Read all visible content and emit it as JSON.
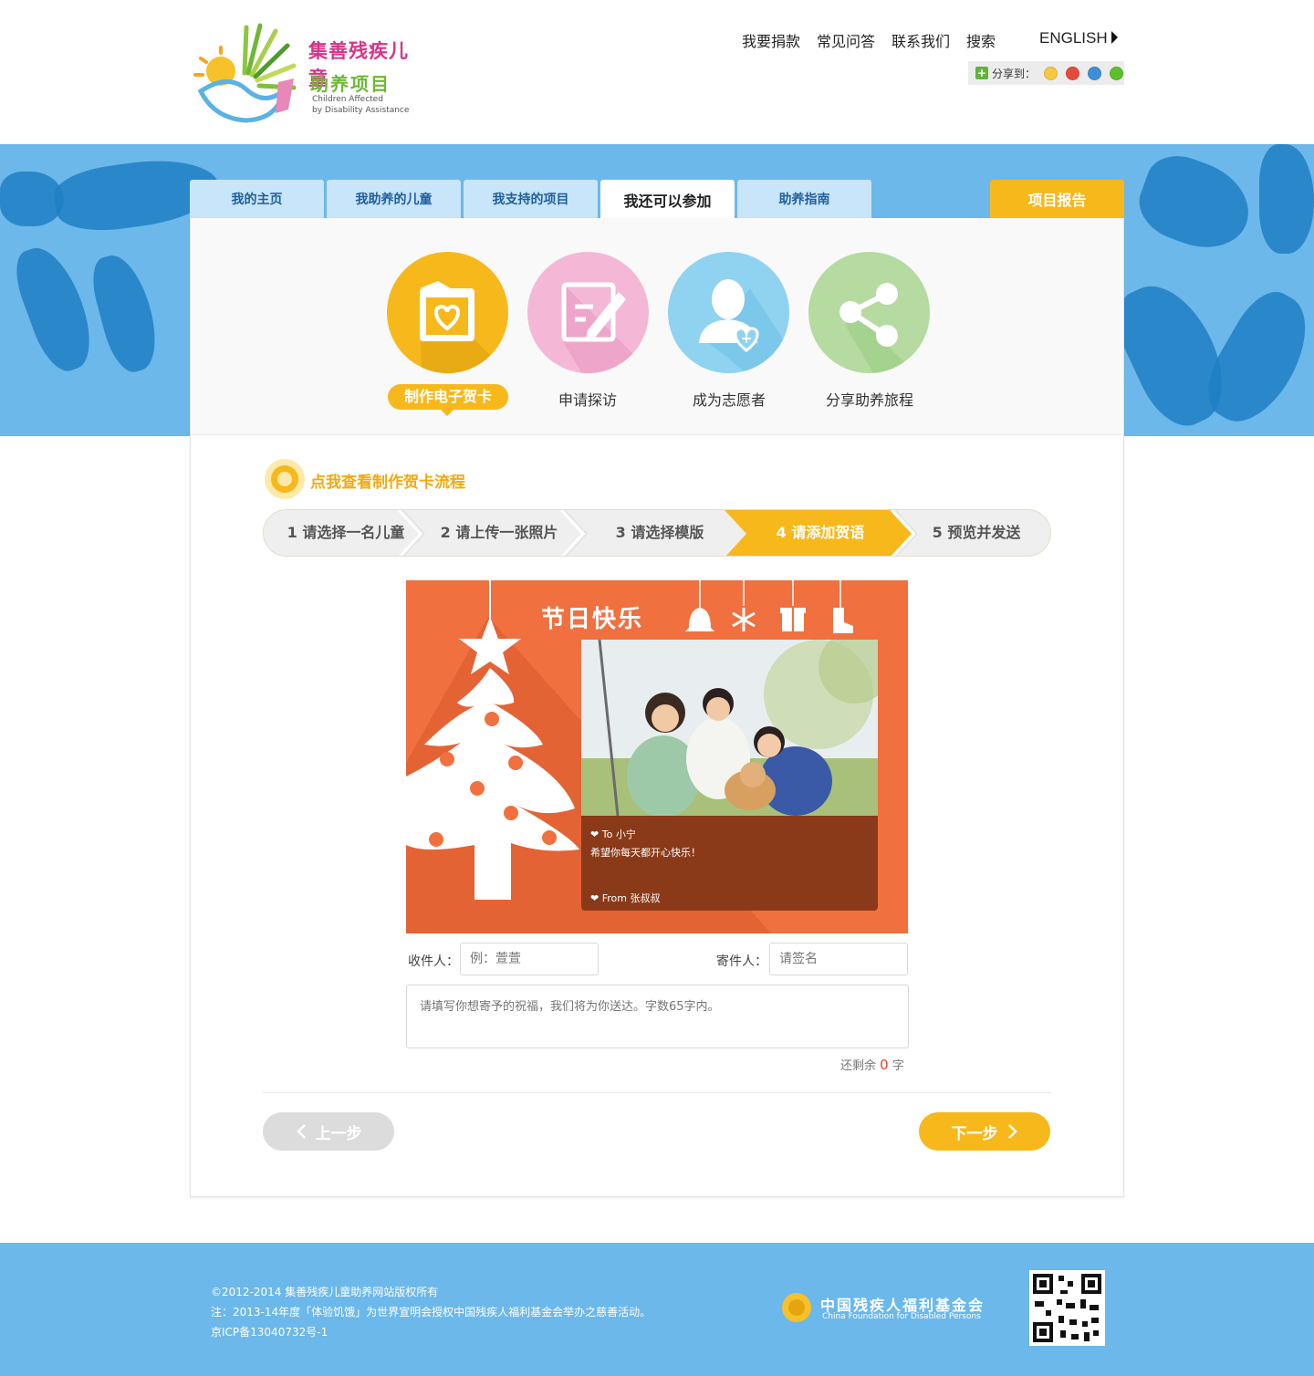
{
  "header": {
    "logo": {
      "title_line1": "集善残疾儿童",
      "title_line2": "助养项目",
      "en_line1": "Children Affected",
      "en_line2": "by Disability Assistance"
    },
    "nav": [
      "我要捐款",
      "常见问答",
      "联系我们",
      "搜索"
    ],
    "english_label": "ENGLISH",
    "share_label": "分享到："
  },
  "tabs": [
    {
      "label": "我的主页"
    },
    {
      "label": "我助养的儿童"
    },
    {
      "label": "我支持的项目"
    },
    {
      "label": "我还可以参加",
      "active": true
    },
    {
      "label": "助养指南"
    }
  ],
  "report_tab": "项目报告",
  "activities": [
    {
      "label": "制作电子贺卡",
      "icon": "ecard-heart-icon",
      "color": "#f7b81c",
      "selected": true
    },
    {
      "label": "申请探访",
      "icon": "edit-form-icon",
      "color": "#f4b8d6"
    },
    {
      "label": "成为志愿者",
      "icon": "volunteer-icon",
      "color": "#8fd3f0"
    },
    {
      "label": "分享助养旅程",
      "icon": "share-icon",
      "color": "#b5dba0"
    }
  ],
  "process_link": "点我查看制作贺卡流程",
  "steps": [
    {
      "num": "1",
      "label": "请选择一名儿童"
    },
    {
      "num": "2",
      "label": "请上传一张照片"
    },
    {
      "num": "3",
      "label": "请选择模版"
    },
    {
      "num": "4",
      "label": "请添加贺语",
      "current": true
    },
    {
      "num": "5",
      "label": "预览并发送"
    }
  ],
  "card": {
    "title": "节日快乐",
    "to_label": "To",
    "to_name": "小宁",
    "message": "希望你每天都开心快乐！",
    "from_label": "From",
    "from_name": "张叔叔"
  },
  "form": {
    "recipient_label": "收件人：",
    "recipient_placeholder": "例：萱萱",
    "sender_label": "寄件人：",
    "sender_placeholder": "请签名",
    "blessing_placeholder": "请填写你想寄予的祝福，我们将为你送达。字数65字内。",
    "remain_prefix": "还剩余",
    "remain_count": "0",
    "remain_suffix": "字"
  },
  "buttons": {
    "prev": "上一步",
    "next": "下一步"
  },
  "footer": {
    "copyright": "©2012-2014 集善残疾儿童助养网站版权所有",
    "note": "注：2013-14年度「体验饥饿」为世界宣明会授权中国残疾人福利基金会举办之慈善活动。",
    "icp": "京ICP备13040732号-1",
    "foundation_cn": "中国残疾人福利基金会",
    "foundation_en": "China Foundation for Disabled Persons"
  },
  "colors": {
    "accent": "#f7b81c",
    "sky": "#6cb8ea",
    "card": "#f07040"
  }
}
